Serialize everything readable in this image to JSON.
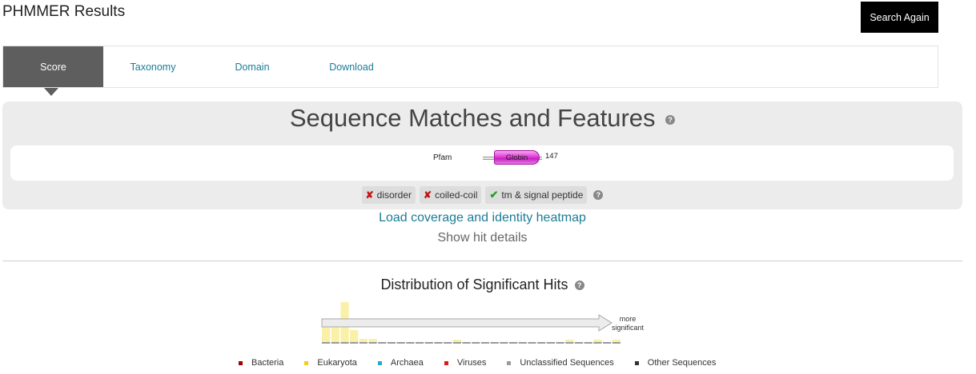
{
  "page": {
    "title": "PHMMER Results"
  },
  "header": {
    "search_again_label": "Search Again"
  },
  "tabs": [
    {
      "label": "Score",
      "active": true
    },
    {
      "label": "Taxonomy",
      "active": false
    },
    {
      "label": "Domain",
      "active": false
    },
    {
      "label": "Download",
      "active": false
    }
  ],
  "features": {
    "title": "Sequence Matches and Features",
    "help_icon": "question-icon",
    "track": {
      "source_label": "Pfam",
      "domain_label": "Globin",
      "sequence_length": "147",
      "domain_color": "#d633d0"
    },
    "badges": [
      {
        "label": "disorder",
        "status": "absent",
        "icon": "cross-icon"
      },
      {
        "label": "coiled-coil",
        "status": "absent",
        "icon": "cross-icon"
      },
      {
        "label": "tm & signal peptide",
        "status": "present",
        "icon": "check-icon"
      }
    ]
  },
  "links": {
    "heatmap": "Load coverage and identity heatmap",
    "hit_details": "Show hit details"
  },
  "distribution": {
    "title": "Distribution of Significant Hits",
    "arrow_label_line1": "more",
    "arrow_label_line2": "significant",
    "bin_fractions": [
      0.45,
      0.45,
      1.0,
      0.3,
      0.08,
      0.08,
      0,
      0,
      0,
      0,
      0,
      0,
      0,
      0,
      0.06,
      0,
      0,
      0,
      0,
      0,
      0,
      0,
      0,
      0,
      0,
      0,
      0.06,
      0,
      0,
      0.06,
      0,
      0.06
    ]
  },
  "legend": [
    {
      "label": "Bacteria",
      "color": "#a30000"
    },
    {
      "label": "Eukaryota",
      "color": "#f0d010"
    },
    {
      "label": "Archaea",
      "color": "#2aa8cc"
    },
    {
      "label": "Viruses",
      "color": "#e01818"
    },
    {
      "label": "Unclassified Sequences",
      "color": "#9a9a9a"
    },
    {
      "label": "Other Sequences",
      "color": "#333333"
    }
  ],
  "colors": {
    "link": "#1b7c98",
    "active_tab": "#5e5e5e",
    "eukaryota_bar": "#faf0a8"
  }
}
